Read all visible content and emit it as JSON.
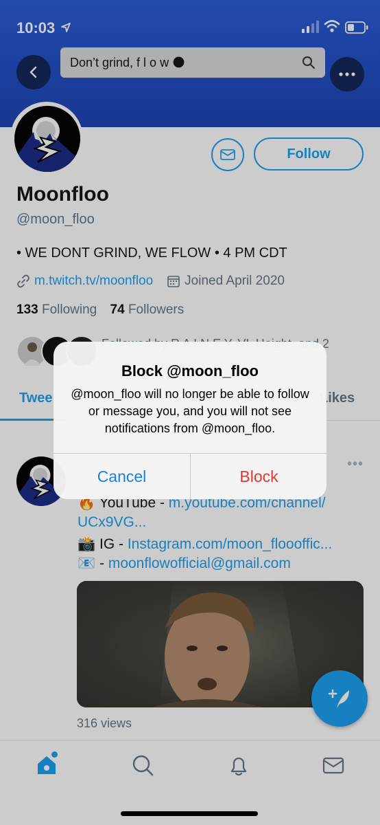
{
  "status": {
    "time": "10:03"
  },
  "header": {
    "search_text": "Don’t grind,  f l o w 🌑"
  },
  "profile": {
    "follow_label": "Follow",
    "name": "Moonfloo",
    "handle": "@moon_floo",
    "bio": "• WE DONT GRIND, WE FLOW • 4 PM CDT",
    "link": "m.twitch.tv/moonfloo",
    "joined": "Joined April 2020",
    "following_count": "133",
    "following_label": "Following",
    "followers_count": "74",
    "followers_label": "Followers",
    "followed_by": "Followed by R A I N E Y, VL Height, and 2"
  },
  "tabs": {
    "tweets": "Twee",
    "likes": "Likes"
  },
  "tweet": {
    "more": "•••",
    "line1_emoji": "🔥",
    "line1_text": " YouTube - ",
    "line1_link": "m.youtube.com/channel/",
    "line2_link": "UCx9VG...",
    "line3_emoji": "📸",
    "line3_text": " IG - ",
    "line3_link": "Instagram.com/moon_floooffic...",
    "line4_emoji": "📧",
    "line4_text": " -  ",
    "line4_link": "moonflowofficial@gmail.com",
    "views": "316 views"
  },
  "alert": {
    "title": "Block @moon_floo",
    "message": "@moon_floo will no longer be able to follow or message you, and you will not see notifications from @moon_floo.",
    "cancel": "Cancel",
    "block": "Block"
  },
  "colors": {
    "accent": "#1da1f2",
    "destructive": "#e0382f",
    "banner": "#2451c9"
  }
}
